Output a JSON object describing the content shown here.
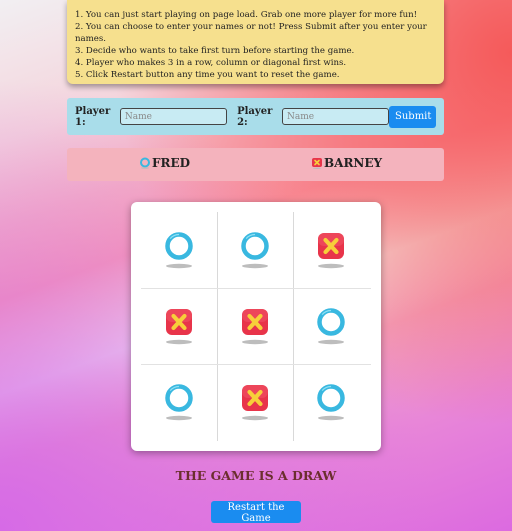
{
  "instructions": {
    "items": [
      "1. You can just start playing on page load. Grab one more player for more fun!",
      "2. You can choose to enter your names or not! Press Submit after you enter your names.",
      "3. Decide who wants to take first turn before starting the game.",
      "4. Player who makes 3 in a row, column or diagonal first wins.",
      "5. Click Restart button any time you want to reset the game."
    ]
  },
  "player_form": {
    "player1_label": "Player 1:",
    "player1_placeholder": "Name",
    "player2_label": "Player 2:",
    "player2_placeholder": "Name",
    "submit_label": "Submit"
  },
  "players": {
    "player1": {
      "name": "FRED",
      "icon": "circle-icon"
    },
    "player2": {
      "name": "BARNEY",
      "icon": "cross-icon"
    }
  },
  "board": {
    "cells": [
      "O",
      "O",
      "X",
      "X",
      "X",
      "O",
      "O",
      "X",
      "O"
    ],
    "colors": {
      "circle": "#39b8e0",
      "cross": "#e8344a"
    }
  },
  "status": {
    "result": "THE GAME IS A DRAW"
  },
  "controls": {
    "restart_label": "Restart the Game"
  }
}
